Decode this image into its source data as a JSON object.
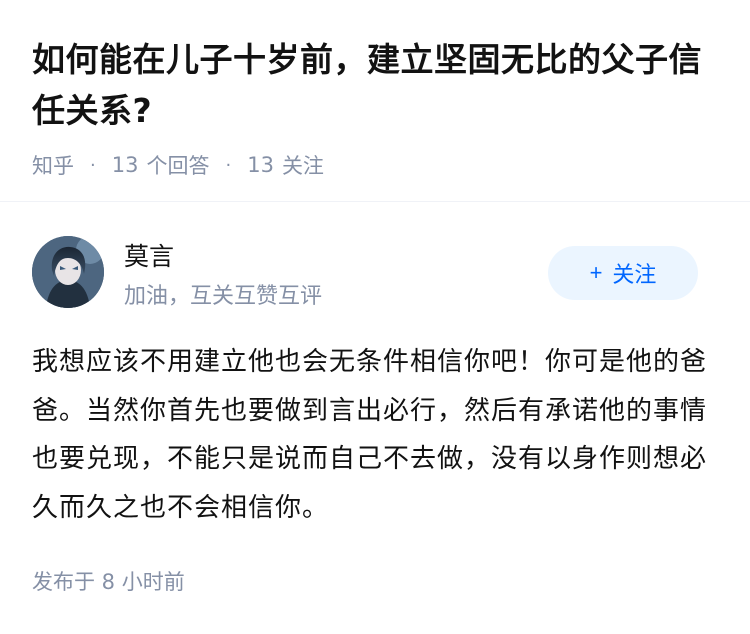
{
  "question": {
    "title": "如何能在儿子十岁前，建立坚固无比的父子信任关系?",
    "source": "知乎",
    "answer_count": "13",
    "answer_label": "个回答",
    "follow_count": "13",
    "follow_label": "关注"
  },
  "answer": {
    "author_name": "莫言",
    "author_bio": "加油，互关互赞互评",
    "follow_button_label": "关注",
    "follow_button_icon": "+",
    "content": "我想应该不用建立他也会无条件相信你吧！你可是他的爸爸。当然你首先也要做到言出必行，然后有承诺他的事情也要兑现，不能只是说而自己不去做，没有以身作则想必久而久之也不会相信你。",
    "published": "发布于  8 小时前"
  },
  "colors": {
    "title": "#121212",
    "meta": "#8590a6",
    "accent": "#0066ff",
    "button_bg": "#ebf5ff"
  },
  "icons": {
    "avatar": "avatar-image"
  }
}
